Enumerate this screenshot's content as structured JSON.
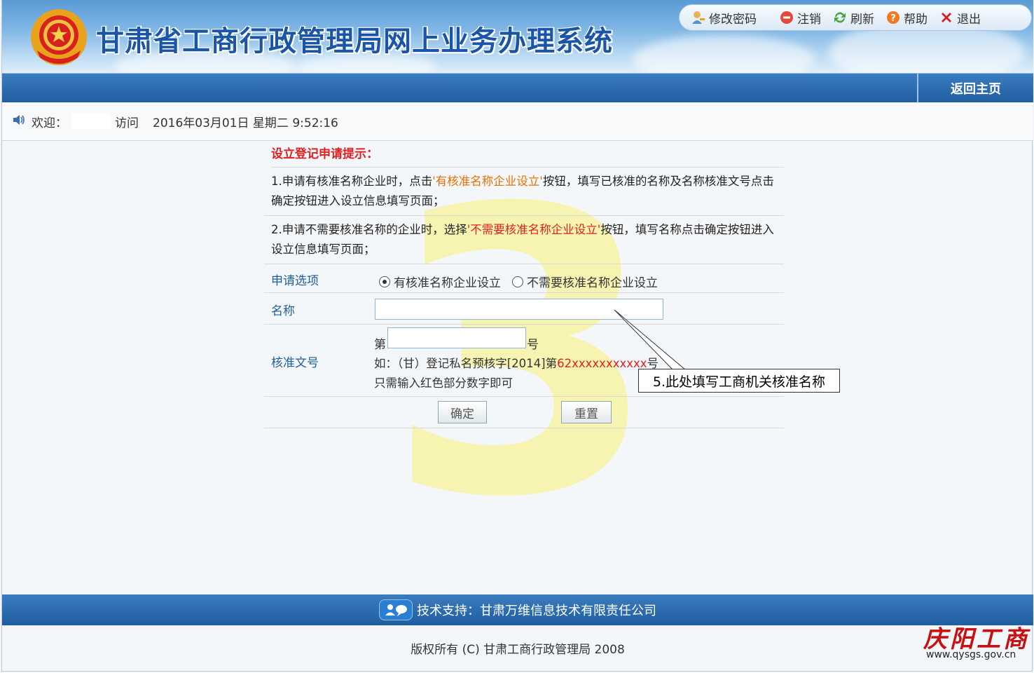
{
  "header": {
    "site_title": "甘肃省工商行政管理局网上业务办理系统",
    "toolbar": [
      {
        "label": "修改密码",
        "icon": "user-key-icon"
      },
      {
        "label": "注销",
        "icon": "logout-icon"
      },
      {
        "label": "刷新",
        "icon": "refresh-icon"
      },
      {
        "label": "帮助",
        "icon": "help-icon"
      },
      {
        "label": "退出",
        "icon": "close-icon"
      }
    ]
  },
  "nav": {
    "home_label": "返回主页"
  },
  "welcome": {
    "prefix": "欢迎：",
    "visit": "访问",
    "datetime": "2016年03月01日 星期二 9:52:16"
  },
  "form": {
    "tips_title": "设立登记申请提示：",
    "tip1": {
      "before": "1.申请有核准名称企业时，点击",
      "highlight": "'有核准名称企业设立'",
      "after": "按钮，填写已核准的名称及名称核准文号点击确定按钮进入设立信息填写页面；"
    },
    "tip2": {
      "before": "2.申请不需要核准名称的企业时，选择",
      "highlight": "'不需要核准名称企业设立'",
      "after": "按钮，填写名称点击确定按钮进入设立信息填写页面；"
    },
    "option_label": "申请选项",
    "option_a": "有核准名称企业设立",
    "option_b": "不需要核准名称企业设立",
    "selected_option": "有核准名称企业设立",
    "name_label": "名称",
    "name_value": "",
    "doc_label": "核准文号",
    "doc_prefix": "第",
    "doc_value": "",
    "doc_suffix": "号",
    "example_prefix": "如：（甘）登记私名预核字[2014]第",
    "example_red": "62xxxxxxxxxxx",
    "example_suffix": "号",
    "note": "只需输入红色部分数字即可",
    "confirm_label": "确定",
    "reset_label": "重置"
  },
  "overlay": {
    "step_number": "3",
    "callout": "5.此处填写工商机关核准名称"
  },
  "footer": {
    "support": "技术支持：甘肃万维信息技术有限责任公司",
    "copyright": "版权所有 (C) 甘肃工商行政管理局 2008",
    "brand": "庆阳工商",
    "brand_url": "www.qysgs.gov.cn"
  },
  "colors": {
    "primary_blue": "#1f5e9f",
    "tip_red": "#e02020",
    "tip_orange": "#e86f00"
  }
}
